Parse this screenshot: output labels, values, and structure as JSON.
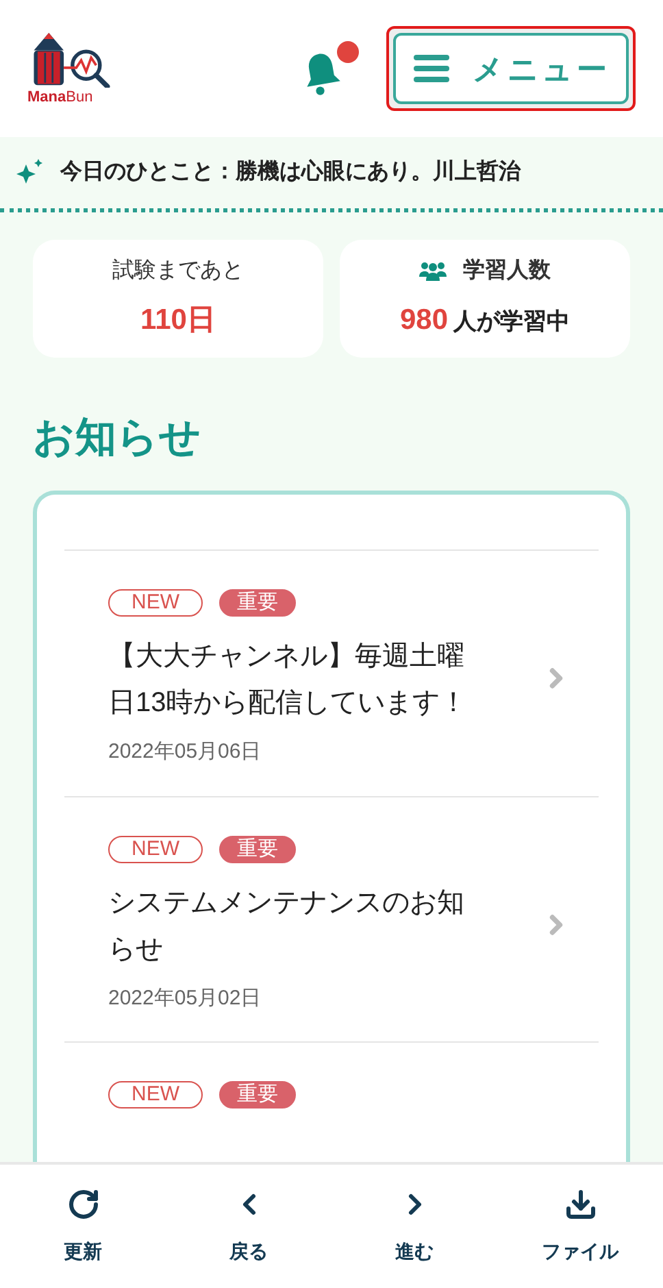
{
  "header": {
    "logo_text": "ManaBun",
    "notification": {
      "unread": true
    },
    "menu_button": {
      "label": "メニュー",
      "highlighted": true
    }
  },
  "quote": {
    "text": "今日のひとこと：勝機は心眼にあり。川上哲治"
  },
  "stats": [
    {
      "kind": "countdown",
      "label": "試験まであと",
      "value": "110日"
    },
    {
      "kind": "learners",
      "label": "学習人数",
      "value": "980",
      "suffix": "人が学習中"
    }
  ],
  "news": {
    "heading": "お知らせ",
    "items": [
      {
        "badges": [
          {
            "kind": "outline",
            "label": "NEW"
          },
          {
            "kind": "filled",
            "label": "重要"
          }
        ],
        "title": "【大大チャンネル】毎週土曜日13時から配信しています！",
        "date": "2022年05月06日"
      },
      {
        "badges": [
          {
            "kind": "outline",
            "label": "NEW"
          },
          {
            "kind": "filled",
            "label": "重要"
          }
        ],
        "title": "システムメンテナンスのお知らせ",
        "date": "2022年05月02日"
      },
      {
        "badges": [
          {
            "kind": "outline",
            "label": "NEW"
          },
          {
            "kind": "filled",
            "label": "重要"
          }
        ]
      }
    ]
  },
  "bottom_nav": [
    {
      "kind": "reload",
      "label": "更新"
    },
    {
      "kind": "back",
      "label": "戻る"
    },
    {
      "kind": "forward",
      "label": "進む"
    },
    {
      "kind": "download",
      "label": "ファイル"
    }
  ]
}
